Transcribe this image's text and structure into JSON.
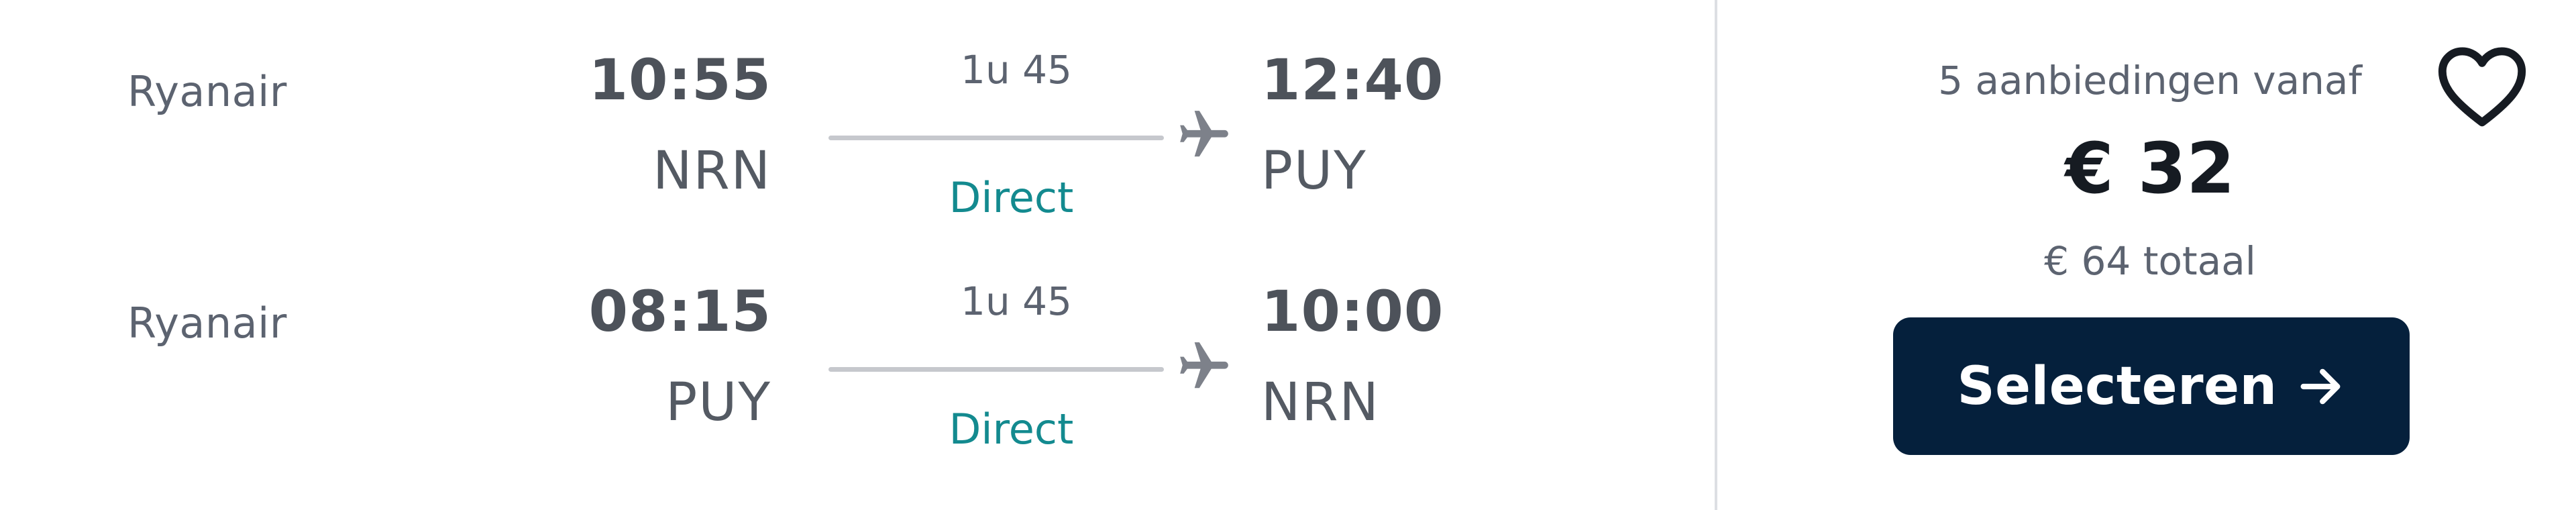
{
  "legs": [
    {
      "airline": "Ryanair",
      "departure_time": "10:55",
      "departure_airport": "NRN",
      "duration": "1u 45",
      "stops": "Direct",
      "arrival_time": "12:40",
      "arrival_airport": "PUY"
    },
    {
      "airline": "Ryanair",
      "departure_time": "08:15",
      "departure_airport": "PUY",
      "duration": "1u 45",
      "stops": "Direct",
      "arrival_time": "10:00",
      "arrival_airport": "NRN"
    }
  ],
  "pricing": {
    "offers_text": "5 aanbiedingen vanaf",
    "price": "€ 32",
    "total": "€ 64 totaal",
    "select_label": "Selecteren"
  },
  "icons": {
    "plane": "plane-icon",
    "arrow": "arrow-right-icon",
    "favorite": "heart-outline-icon"
  },
  "colors": {
    "stops_direct": "#138a8f",
    "button_background": "#05203c",
    "button_text": "#ffffff"
  }
}
